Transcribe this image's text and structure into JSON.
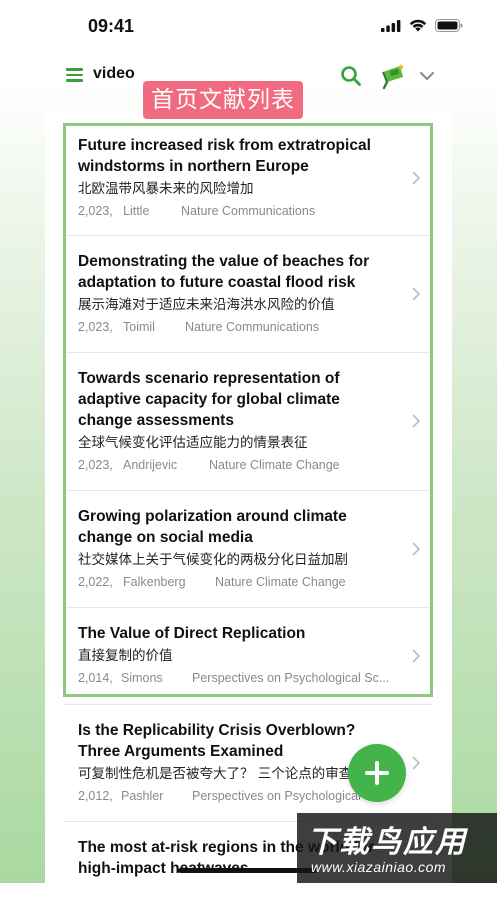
{
  "status_bar": {
    "time": "09:41"
  },
  "header": {
    "title": "video"
  },
  "tag_label": "首页文献列表",
  "items": [
    {
      "title": "Future increased risk from extratropical windstorms in northern Europe",
      "subtitle": "北欧温带风暴未来的风险增加",
      "year": "2,023,",
      "author": "Little",
      "journal": "Nature Communications"
    },
    {
      "title": "Demonstrating the value of beaches for adaptation to future coastal flood risk",
      "subtitle": "展示海滩对于适应未来沿海洪水风险的价值",
      "year": "2,023,",
      "author": "Toimil",
      "journal": "Nature Communications"
    },
    {
      "title": "Towards scenario representation of adaptive capacity for global climate change assessments",
      "subtitle": "全球气候变化评估适应能力的情景表征",
      "year": "2,023,",
      "author": "Andrijevic",
      "journal": "Nature Climate Change"
    },
    {
      "title": "Growing polarization around climate change on social media",
      "subtitle": "社交媒体上关于气候变化的两极分化日益加剧",
      "year": "2,022,",
      "author": "Falkenberg",
      "journal": "Nature Climate Change"
    },
    {
      "title": "The Value of Direct Replication",
      "subtitle": "直接复制的价值",
      "year": "2,014,",
      "author": "Simons",
      "journal": "Perspectives on Psychological Sc..."
    },
    {
      "title": "Is the Replicability Crisis Overblown? Three Arguments Examined",
      "subtitle": "可复制性危机是否被夸大了？ 三个论点的审查",
      "year": "2,012,",
      "author": "Pashler",
      "journal": "Perspectives on Psychological Sc..."
    },
    {
      "title": "The most at-risk regions in the world for high-impact heatwaves",
      "subtitle": "",
      "year": "",
      "author": "",
      "journal": ""
    }
  ],
  "watermark": {
    "main": "下载鸟应用",
    "url": "www.xiazainiao.com"
  },
  "colors": {
    "accent": "#43b449",
    "tag": "#f06b80",
    "highlight": "#8cc97f"
  }
}
